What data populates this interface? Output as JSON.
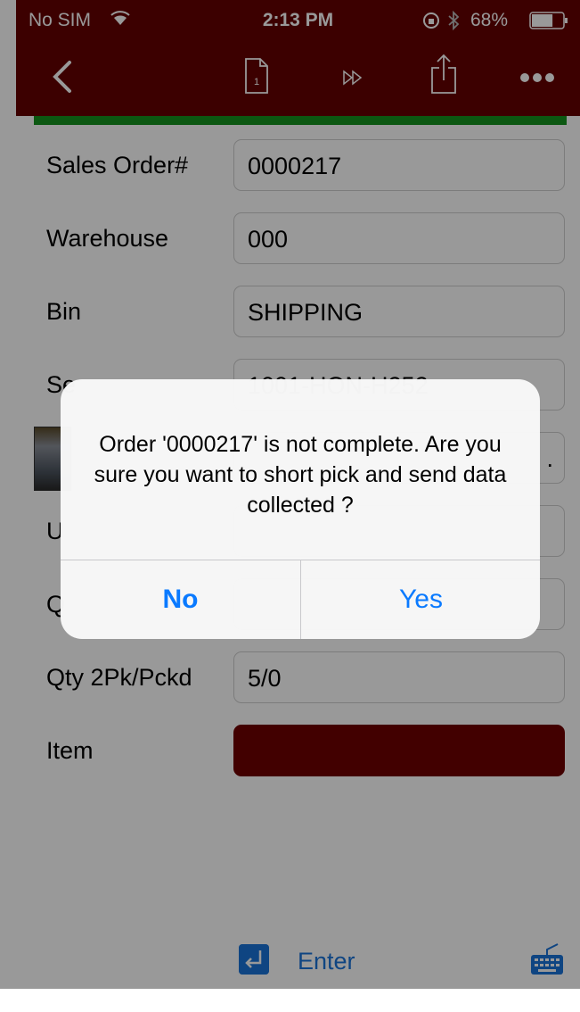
{
  "status_bar": {
    "carrier": "No SIM",
    "time": "2:13 PM",
    "battery": "68%",
    "battery_level": 0.68,
    "icons": [
      "wifi-icon",
      "rotation-lock-icon",
      "bluetooth-icon",
      "battery-icon"
    ]
  },
  "nav_bar": {
    "background": "#640000",
    "icons": [
      "back-chevron-icon",
      "page-icon",
      "fast-forward-icon",
      "share-icon",
      "more-icon"
    ],
    "page_number": "1"
  },
  "form": {
    "status_color": "#14931e",
    "rows": [
      {
        "label": "Sales Order#",
        "value": "0000217"
      },
      {
        "label": "Warehouse",
        "value": "000"
      },
      {
        "label": "Bin",
        "value": "SHIPPING"
      },
      {
        "label": "Se",
        "value": "1001-HON-H252"
      },
      {
        "label": "",
        "value": "."
      },
      {
        "label": "U",
        "value": ""
      },
      {
        "label": "Q",
        "value": ""
      },
      {
        "label": "Qty 2Pk/Pckd",
        "value": "5/0"
      },
      {
        "label": "Item",
        "value": ""
      }
    ],
    "item_field_color": "#6e0000"
  },
  "toolbar": {
    "enter_label": "Enter",
    "icons": [
      "enter-icon",
      "keyboard-icon"
    ],
    "accent": "#1a73d9"
  },
  "alert": {
    "message": "Order '0000217'  is not complete. Are you sure you want to short pick and send data collected ?",
    "no_label": "No",
    "yes_label": "Yes",
    "button_color": "#0a7aff"
  }
}
